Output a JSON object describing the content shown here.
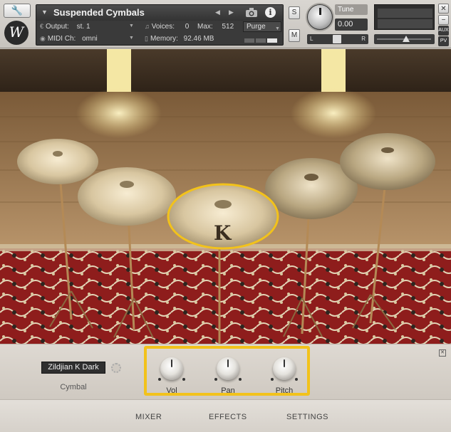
{
  "header": {
    "instrument_title": "Suspended Cymbals",
    "output_label": "Output:",
    "output_value": "st. 1",
    "voices_label": "Voices:",
    "voices_value": "0",
    "max_label": "Max:",
    "max_value": "512",
    "purge_label": "Purge",
    "midi_label": "MIDI Ch:",
    "midi_value": "omni",
    "memory_label": "Memory:",
    "memory_value": "92.46 MB",
    "solo_label": "S",
    "mute_label": "M",
    "tune_label": "Tune",
    "tune_value": "0.00",
    "pan_left": "L",
    "pan_right": "R",
    "aux_label": "AUX",
    "pv_label": "PV",
    "logo_letter": "W"
  },
  "controls": {
    "cymbal_selected": "Zildjian K Dark",
    "cymbal_caption": "Cymbal",
    "knobs": [
      {
        "label": "Vol"
      },
      {
        "label": "Pan"
      },
      {
        "label": "Pitch"
      }
    ]
  },
  "tabs": [
    "MIXER",
    "EFFECTS",
    "SETTINGS"
  ],
  "colors": {
    "highlight_frame": "#f2c21b",
    "rug_red": "#8e1d1c",
    "floor_wood": "#a8845b"
  },
  "icons": [
    "wrench-icon",
    "camera-icon",
    "info-icon",
    "gear-icon",
    "expand-icon",
    "close-icon"
  ]
}
